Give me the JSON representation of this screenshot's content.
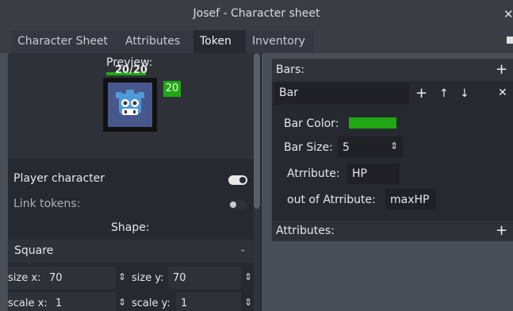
{
  "window": {
    "title": "Josef - Character sheet",
    "close_glyph": "✕"
  },
  "tabs": [
    {
      "label": "Character Sheet",
      "active": false
    },
    {
      "label": "Attributes",
      "active": false
    },
    {
      "label": "Token",
      "active": true
    },
    {
      "label": "Inventory",
      "active": false
    }
  ],
  "token": {
    "preview_label": "Preview:",
    "hp_text": "20/20",
    "hp_fraction": 1.0,
    "badge_value": "20",
    "icon": "godot-robot-icon"
  },
  "settings": {
    "player_character_label": "Player character",
    "player_character_on": true,
    "link_tokens_label": "Link tokens:",
    "link_tokens_on": false,
    "shape_label": "Shape:",
    "shape_value": "Square",
    "size_x_label": "size x:",
    "size_x_value": "70",
    "size_y_label": "size y:",
    "size_y_value": "70",
    "scale_x_label": "scale x:",
    "scale_x_value": "1",
    "scale_y_label": "scale y:",
    "scale_y_value": "1"
  },
  "bars": {
    "header": "Bars:",
    "name": "Bar",
    "color_label": "Bar Color:",
    "color": "#1fa812",
    "size_label": "Bar Size:",
    "size_value": "5",
    "attribute_label": "Atrribute:",
    "attribute_value": "HP",
    "max_label": "out of Atrribute:",
    "max_value": "maxHP"
  },
  "attributes": {
    "header": "Attributes:"
  },
  "colors": {
    "accent_green": "#1fa812",
    "panel_bg": "#262930",
    "window_bg": "#4a4e57"
  }
}
